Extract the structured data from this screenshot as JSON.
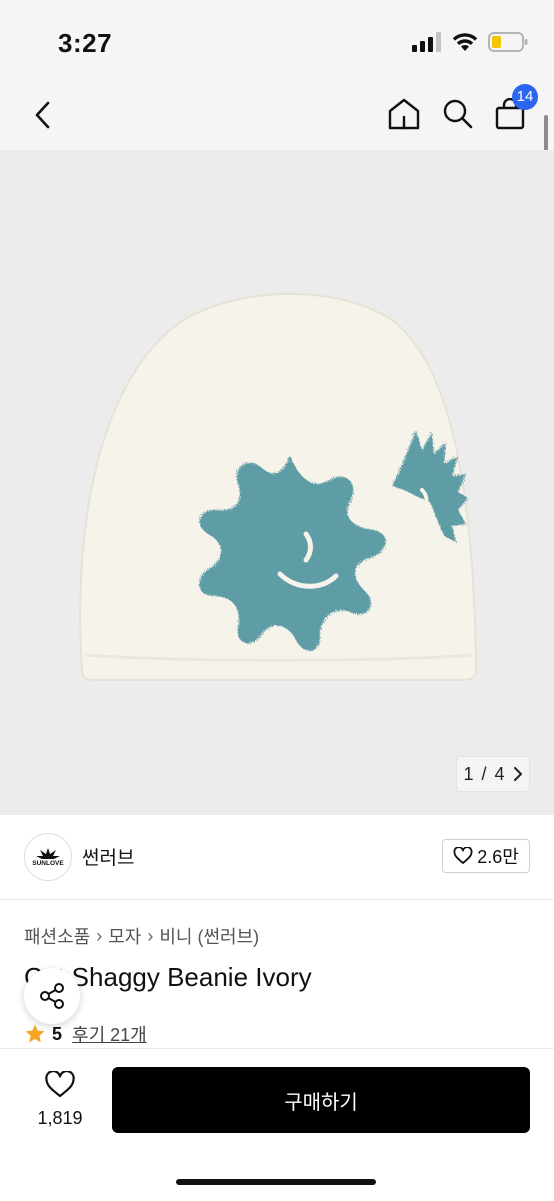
{
  "status_bar": {
    "time": "3:27"
  },
  "nav": {
    "cart_badge": "14"
  },
  "gallery": {
    "current": "1",
    "separator": "/",
    "total": "4"
  },
  "seller": {
    "name": "썬러브",
    "logo_text": "SUNLOVE",
    "likes": "2.6만"
  },
  "breadcrumb": [
    "패션소품",
    "모자",
    "비니 (썬러브)"
  ],
  "product": {
    "title": "Cat Shaggy Beanie Ivory",
    "rating": "5",
    "reviews": "후기 21개"
  },
  "bottom": {
    "wish_count": "1,819",
    "buy_label": "구매하기"
  },
  "colors": {
    "accent_badge": "#2a66f0",
    "beanie": "#f6f3ea",
    "pattern": "#5e9da6",
    "star": "#f5a623"
  }
}
